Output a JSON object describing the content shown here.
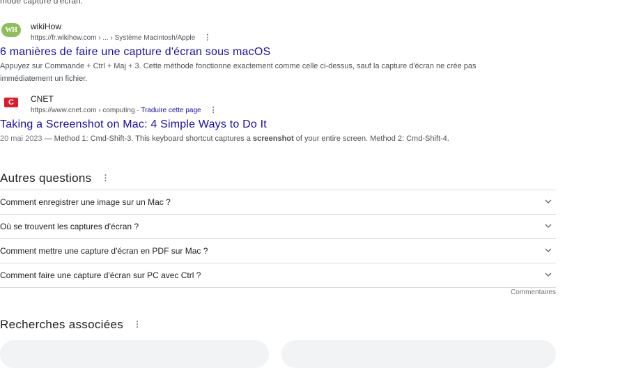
{
  "top_fragment": "mode capture d'écran.",
  "results": [
    {
      "favicon": "WH",
      "site_name": "wikiHow",
      "url": "https://fr.wikihow.com › ... › Système Macintosh/Apple",
      "title": "6 manières de faire une capture d'écran sous macOS",
      "snippet": "Appuyez sur Commande + Ctrl + Maj + 3. Cette méthode fonctionne exactement comme celle ci-dessus, sauf la capture d'écran ne crée pas immédiatement un fichier."
    },
    {
      "favicon": "C",
      "site_name": "CNET",
      "url": "https://www.cnet.com › computing",
      "url_sep": " · ",
      "translate_label": "Traduire cette page",
      "title": "Taking a Screenshot on Mac: 4 Simple Ways to Do It",
      "date": "20 mai 2023",
      "snippet_before": " — Method 1: Cmd-Shift-3. This keyboard shortcut captures a ",
      "snippet_bold": "screenshot",
      "snippet_after": " of your entire screen. Method 2: Cmd-Shift-4."
    }
  ],
  "kebab": "⋮",
  "paa": {
    "title": "Autres questions",
    "questions": [
      "Comment enregistrer une image sur un Mac ?",
      "Où se trouvent les captures d'écran ?",
      "Comment mettre une capture d'écran en PDF sur Mac ?",
      "Comment faire une capture d'écran sur PC avec Ctrl ?"
    ],
    "feedback": "Commentaires"
  },
  "related": {
    "title": "Recherches associées"
  },
  "icons": {
    "chevron": "chevron-down-icon",
    "more": "more-vert-icon"
  }
}
